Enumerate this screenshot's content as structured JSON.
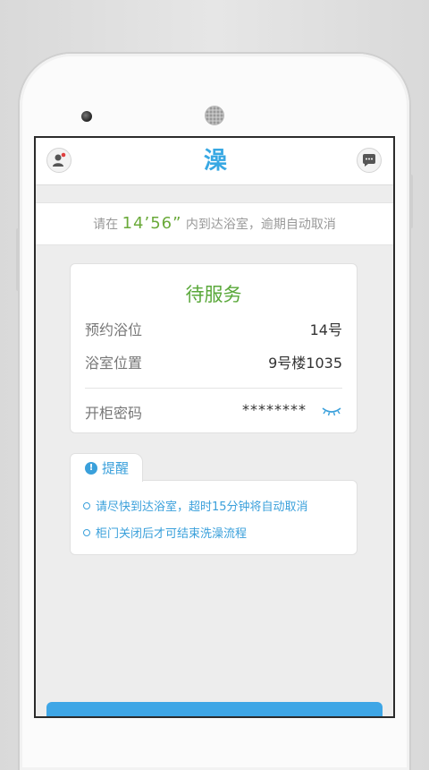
{
  "header": {
    "logo_char": "澡",
    "profile_icon": "user-icon",
    "message_icon": "chat-bubble-icon"
  },
  "notice": {
    "prefix": "请在",
    "timer": "14’56”",
    "suffix": "内到达浴室，逾期自动取消"
  },
  "order": {
    "status": "待服务",
    "rows": [
      {
        "label": "预约浴位",
        "value": "14号"
      },
      {
        "label": "浴室位置",
        "value": "9号楼1035"
      }
    ],
    "password_label": "开柜密码",
    "password_value": "********",
    "eye_icon": "eye-closed-icon"
  },
  "reminder": {
    "tab_label": "提醒",
    "items": [
      "请尽快到达浴室，超时15分钟将自动取消",
      "柜门关闭后才可结束洗澡流程"
    ]
  },
  "colors": {
    "accent_blue": "#3aa0db",
    "status_green": "#5aa83a",
    "timer_green": "#6aaa3a"
  }
}
